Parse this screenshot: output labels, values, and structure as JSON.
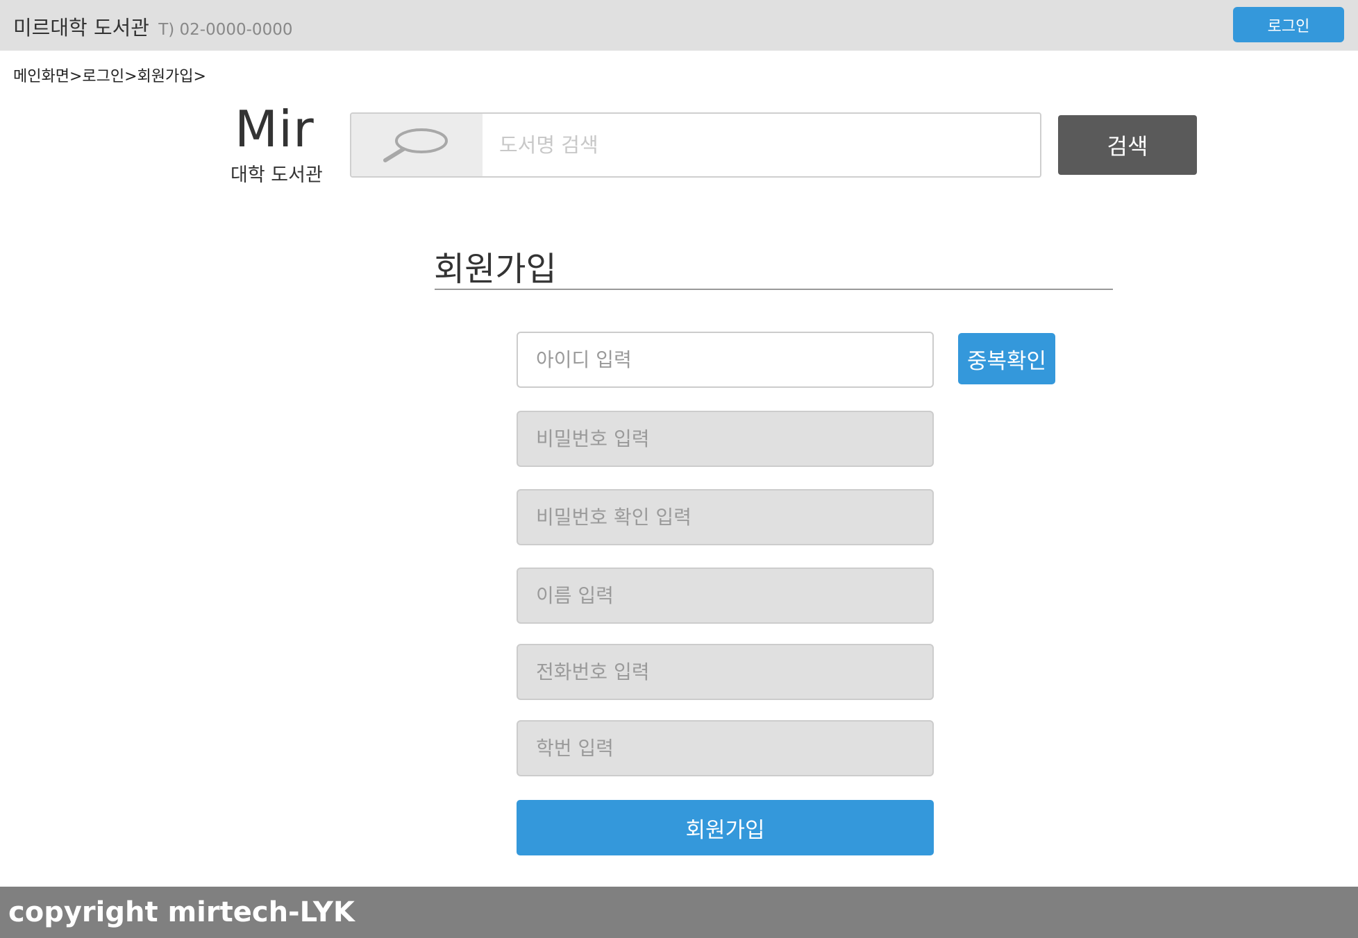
{
  "header": {
    "site_name": "미르대학 도서관",
    "phone": "T) 02-0000-0000",
    "login_label": "로그인"
  },
  "breadcrumb": "메인화면>로그인>회원가입>",
  "logo": {
    "main": "Mir",
    "sub": "대학 도서관"
  },
  "search": {
    "icon": "search-icon",
    "placeholder": "도서명 검색",
    "button_label": "검색"
  },
  "signup": {
    "title": "회원가입",
    "id_placeholder": "아이디 입력",
    "dup_check_label": "중복확인",
    "password_placeholder": "비밀번호 입력",
    "password_confirm_placeholder": "비밀번호 확인 입력",
    "name_placeholder": "이름 입력",
    "phone_placeholder": "전화번호 입력",
    "student_id_placeholder": "학번 입력",
    "submit_label": "회원가입"
  },
  "footer": {
    "copyright": "copyright mirtech-LYK"
  },
  "colors": {
    "accent": "#3498db",
    "topbar": "#e0e0e0",
    "search_button": "#5a5a5a",
    "footer": "#808080"
  }
}
